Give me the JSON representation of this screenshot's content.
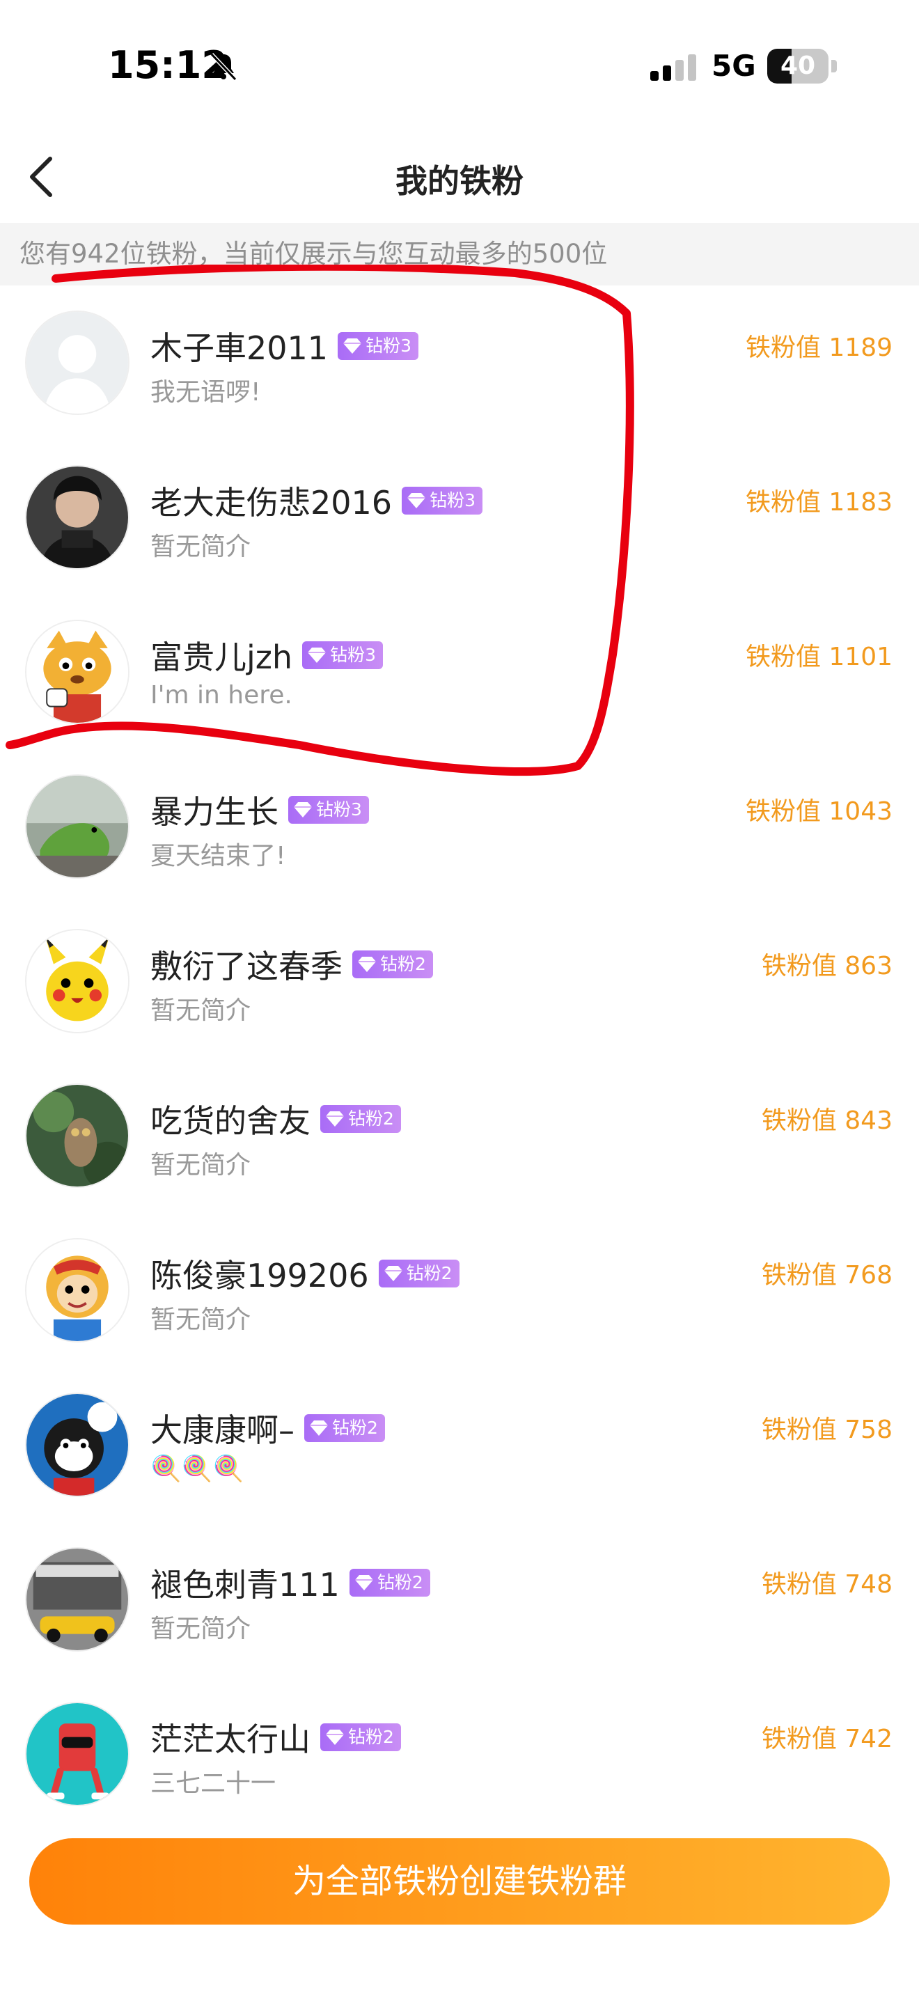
{
  "status_bar": {
    "time": "15:12",
    "network": "5G",
    "battery": "40",
    "battery_level": 0.4,
    "icons": [
      "bell-muted-icon",
      "signal-icon",
      "battery-icon"
    ]
  },
  "header": {
    "title": "我的铁粉",
    "back_icon": "chevron-left-icon"
  },
  "notice": "您有942位铁粉，当前仅展示与您互动最多的500位",
  "colors": {
    "accent_orange": "#f29a1e",
    "badge_purple": "#a96cf6",
    "annotation_red": "#e8000f",
    "button_gradient_start": "#ff8209",
    "button_gradient_end": "#ffb52f"
  },
  "fans": [
    {
      "name": "木子車2011",
      "badge": "钻粉3",
      "bio": "我无语啰!",
      "score": "铁粉值 1189",
      "avatar": "default-avatar"
    },
    {
      "name": "老大走伤悲2016",
      "badge": "钻粉3",
      "bio": "暂无简介",
      "score": "铁粉值 1183",
      "avatar": "man-photo-avatar"
    },
    {
      "name": "富贵儿jzh",
      "badge": "钻粉3",
      "bio": "I'm in here.",
      "score": "铁粉值 1101",
      "avatar": "cartoon-cat-avatar"
    },
    {
      "name": "暴力生长",
      "badge": "钻粉3",
      "bio": "夏天结束了!",
      "score": "铁粉值 1043",
      "avatar": "dinosaur-avatar"
    },
    {
      "name": "敷衍了这春季",
      "badge": "钻粉2",
      "bio": "暂无简介",
      "score": "铁粉值 863",
      "avatar": "pikachu-avatar"
    },
    {
      "name": "吃货的舍友",
      "badge": "钻粉2",
      "bio": "暂无简介",
      "score": "铁粉值 843",
      "avatar": "owl-avatar"
    },
    {
      "name": "陈俊豪199206",
      "badge": "钻粉2",
      "bio": "暂无简介",
      "score": "铁粉值 768",
      "avatar": "monkey-king-avatar"
    },
    {
      "name": "大康康啊–",
      "badge": "钻粉2",
      "bio": "🍭🍭🍭",
      "score": "铁粉值 758",
      "avatar": "cartoon-cat-blue-avatar"
    },
    {
      "name": "褪色刺青111",
      "badge": "钻粉2",
      "bio": "暂无简介",
      "score": "铁粉值 748",
      "avatar": "car-photo-avatar"
    },
    {
      "name": "茫茫太行山",
      "badge": "钻粉2",
      "bio": "三七二十一",
      "score": "铁粉值 742",
      "avatar": "robot-avatar"
    }
  ],
  "bottom": {
    "create_group_label": "为全部铁粉创建铁粉群"
  }
}
